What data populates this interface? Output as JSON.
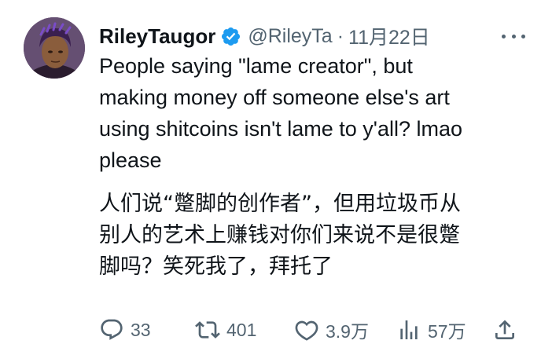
{
  "tweet": {
    "display_name": "RileyTaugor",
    "handle": "@RileyTa",
    "separator": "·",
    "date": "11月22日",
    "avatar_icon": "user-avatar",
    "verified_color": "#1d9bf0",
    "text_lines": [
      "People saying \"lame creator\", but",
      "making money off someone else's art",
      "using shitcoins isn't lame to y'all? lmao",
      "please"
    ],
    "translation_lines": [
      "人们说“蹩脚的创作者”，但用垃圾币从",
      "别人的艺术上赚钱对你们来说不是很蹩",
      "脚吗？笑死我了，拜托了"
    ]
  },
  "actions": {
    "replies": "33",
    "retweets": "401",
    "likes": "3.9万",
    "views": "57万"
  },
  "colors": {
    "text": "#0f1419",
    "muted": "#536471",
    "background": "#ffffff"
  }
}
